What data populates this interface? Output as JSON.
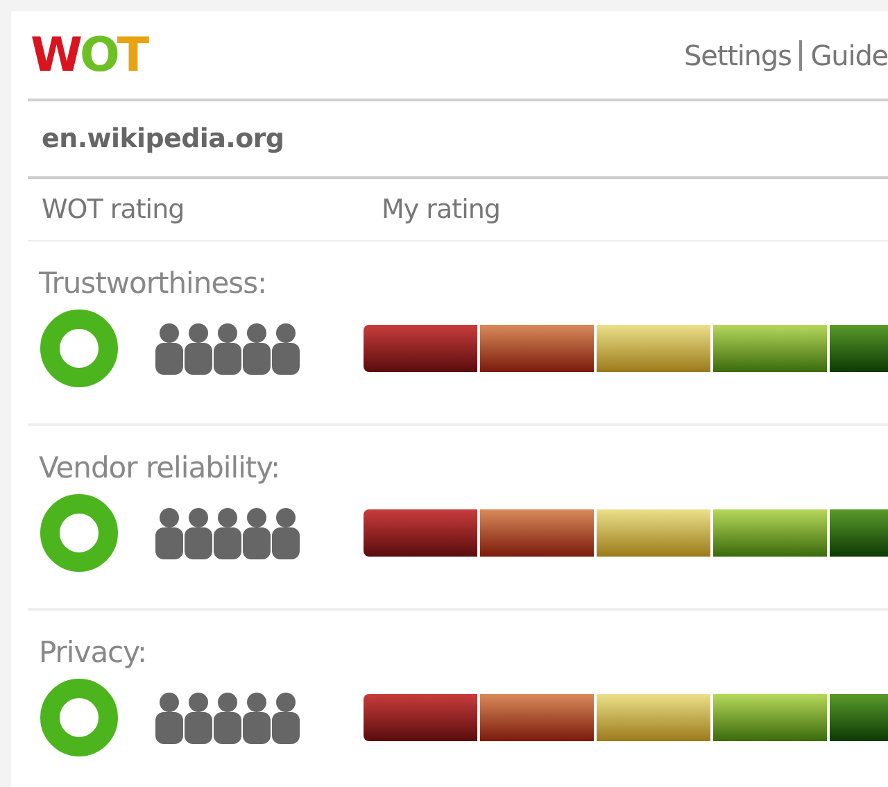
{
  "logo": "WOT",
  "links": [
    "Settings",
    "Guide"
  ],
  "domain": "en.wikipedia.org",
  "columns": [
    "WOT rating",
    "My rating"
  ],
  "categories": [
    {
      "label": "Trustworthiness:",
      "color": "#4cb51e",
      "stars": 5
    },
    {
      "label": "Vendor reliability:",
      "color": "#4cb51e",
      "stars": 5
    },
    {
      "label": "Privacy:",
      "color": "#4cb51e",
      "stars": 5
    }
  ]
}
